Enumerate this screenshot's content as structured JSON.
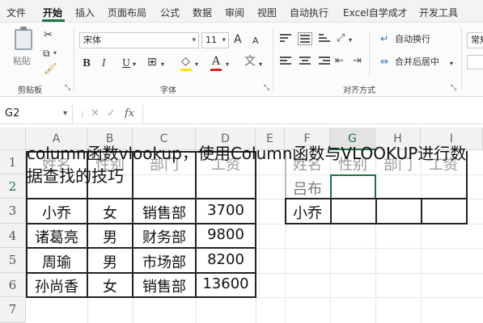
{
  "menu": {
    "tabs": [
      "文件",
      "开始",
      "插入",
      "页面布局",
      "公式",
      "数据",
      "审阅",
      "视图",
      "自动执行",
      "Excel自学成才",
      "开发工具"
    ],
    "active": "开始"
  },
  "ribbon": {
    "clipboard": {
      "paste": "粘贴",
      "group_label": "剪贴板"
    },
    "font": {
      "font_name": "宋体",
      "font_size": "11",
      "grow": "A",
      "shrink": "A",
      "bold": "B",
      "italic": "I",
      "underline": "U",
      "group_label": "字体"
    },
    "alignment": {
      "wrap_text": "自动换行",
      "merge_center": "合并后居中",
      "group_label": "对齐方式"
    },
    "number": {
      "format": "常规"
    }
  },
  "formula_bar": {
    "name_box": "G2",
    "cancel": "✕",
    "enter": "✓",
    "fx": "fx",
    "value": ""
  },
  "columns": [
    "A",
    "B",
    "C",
    "D",
    "E",
    "F",
    "G",
    "H",
    "I"
  ],
  "rows": [
    "1",
    "2",
    "3",
    "4",
    "5",
    "6",
    "7"
  ],
  "table_left": {
    "headers": [
      "姓名",
      "性别",
      "部门",
      "工资"
    ],
    "data": [
      [
        "小乔",
        "女",
        "销售部",
        "3700"
      ],
      [
        "诸葛亮",
        "男",
        "财务部",
        "9800"
      ],
      [
        "周瑜",
        "男",
        "市场部",
        "8200"
      ],
      [
        "孙尚香",
        "女",
        "销售部",
        "13600"
      ]
    ]
  },
  "table_right": {
    "headers": [
      "姓名",
      "性别",
      "部门",
      "工资"
    ],
    "names": [
      "吕布",
      "小乔"
    ]
  },
  "caption": "column函数vlookup，使用Column函数与VLOOKUP进行数据查找的技巧"
}
